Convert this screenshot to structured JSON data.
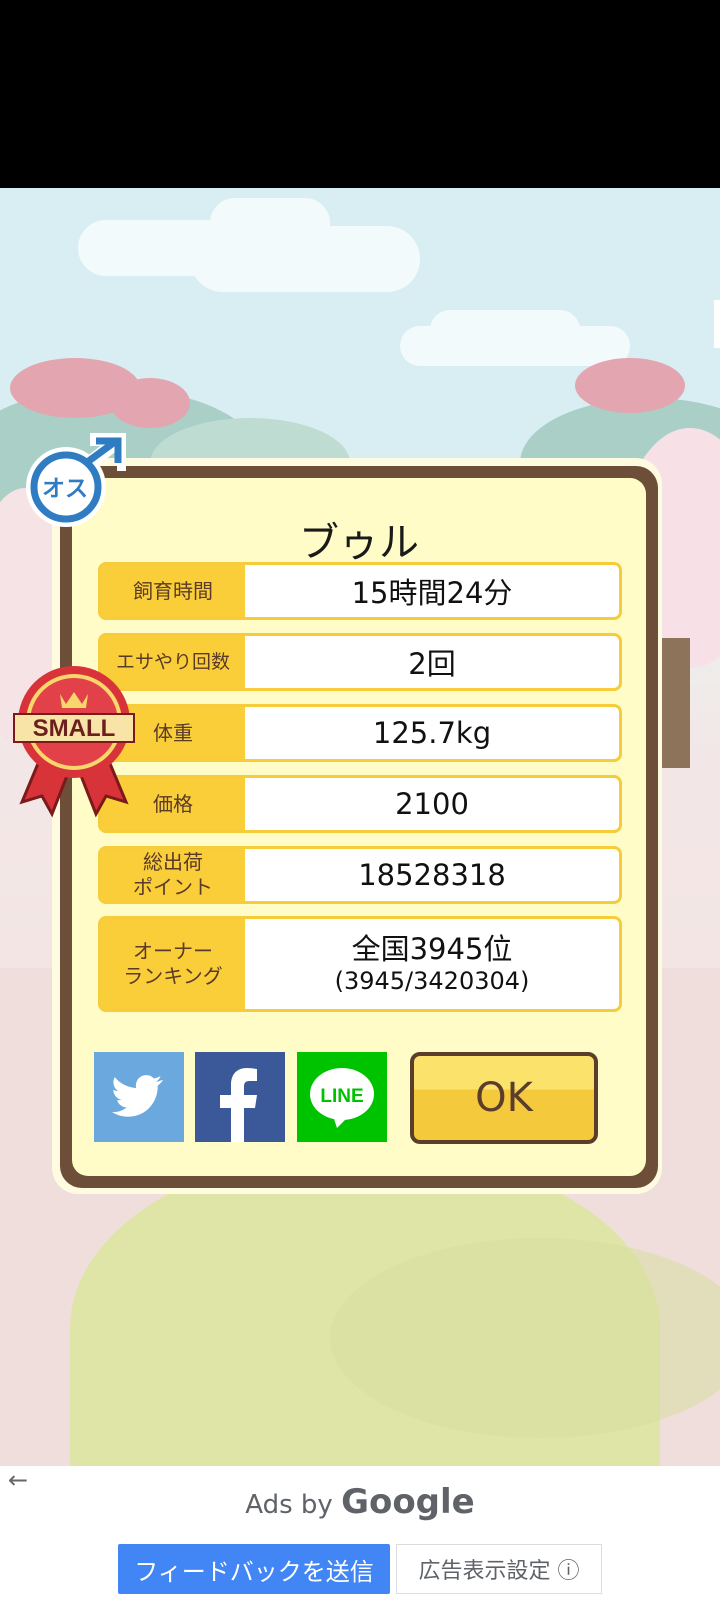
{
  "pig": {
    "name": "ブゥル",
    "gender_label": "オス",
    "size_badge": "SMALL"
  },
  "stats": [
    {
      "label": "飼育時間",
      "value": "15時間24分"
    },
    {
      "label": "エサやり回数",
      "value": "2回"
    },
    {
      "label": "体重",
      "value": "125.7kg"
    },
    {
      "label": "価格",
      "value": "2100"
    },
    {
      "label": "総出荷\nポイント",
      "value": "18528318"
    }
  ],
  "ranking": {
    "label": "オーナー\nランキング",
    "value": "全国3945位",
    "sub": "(3945/3420304)"
  },
  "share": {
    "twitter_icon": "twitter-bird",
    "facebook_icon": "facebook-f",
    "line_label": "LINE"
  },
  "ok_label": "OK",
  "ad": {
    "back_arrow": "←",
    "ads_by": "Ads by",
    "google": "Google",
    "feedback_label": "フィードバックを送信",
    "settings_label": "広告表示設定 ⓘ"
  },
  "colors": {
    "panel_border": "#6d4e38",
    "label_bg": "#f9ce39",
    "panel_bg": "#fffcc8",
    "twitter": "#6aa8dd",
    "facebook": "#3b5998",
    "line": "#00c300",
    "ad_button": "#4285f4"
  }
}
